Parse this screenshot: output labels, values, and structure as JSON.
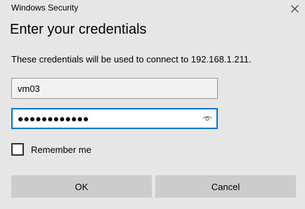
{
  "window": {
    "title": "Windows Security"
  },
  "heading": "Enter your credentials",
  "description": "These credentials will be used to connect to 192.168.1.211.",
  "username": {
    "value": "vm03"
  },
  "password": {
    "masked_value": "●●●●●●●●●●●●",
    "reveal_icon": "eye-icon"
  },
  "remember_me": {
    "label": "Remember me",
    "checked": false
  },
  "buttons": {
    "ok_label": "OK",
    "cancel_label": "Cancel"
  },
  "colors": {
    "background": "#e6e6e6",
    "focus_border": "#0078d7",
    "button": "#cccccc"
  }
}
